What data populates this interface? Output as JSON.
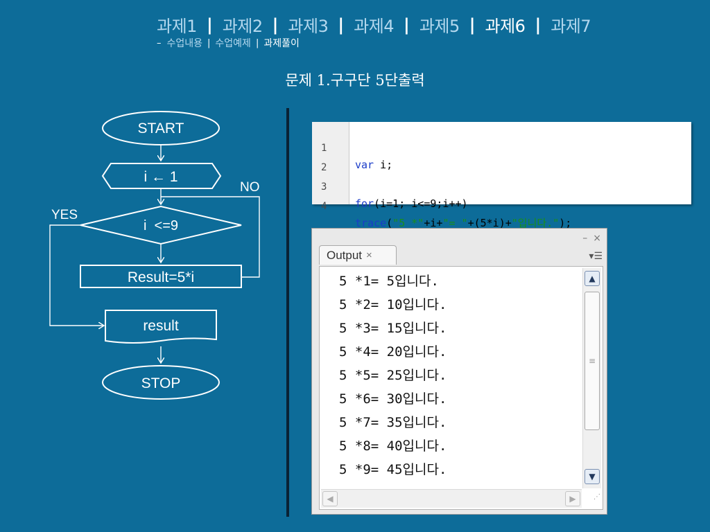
{
  "nav": {
    "tabs": [
      "과제1",
      "과제2",
      "과제3",
      "과제4",
      "과제5",
      "과제6",
      "과제7"
    ],
    "active_tab": "과제6",
    "separator": "|",
    "sub_prefix": "–",
    "sub_items": [
      "수업내용",
      "수업예제",
      "과제풀이"
    ],
    "active_sub": "과제풀이"
  },
  "page_title": "문제 1.구구단 5단출력",
  "flowchart": {
    "start": "START",
    "init": "i ← 1",
    "condition": "i  <=9",
    "process": "Result=5*i",
    "output": "result",
    "stop": "STOP",
    "yes_label": "YES",
    "no_label": "NO"
  },
  "code": {
    "lines": [
      {
        "num": "1",
        "kw": "var",
        "rest": " i;"
      },
      {
        "num": "2",
        "kw": "",
        "rest": ""
      },
      {
        "num": "3",
        "kw": "for",
        "rest": "(i=1; i<=9;i++)"
      },
      {
        "num": "4",
        "kw": "trace",
        "rest": "(\"5 *\"+i+\"= \"+(5*i)+\"입니다.\");"
      }
    ]
  },
  "output_panel": {
    "tab_label": "Output",
    "tab_close": "×",
    "minimize": "–",
    "close": "×",
    "menu_icon": "menu-icon",
    "lines": [
      "5 *1= 5입니다.",
      "5 *2= 10입니다.",
      "5 *3= 15입니다.",
      "5 *4= 20입니다.",
      "5 *5= 25입니다.",
      "5 *6= 30입니다.",
      "5 *7= 35입니다.",
      "5 *8= 40입니다.",
      "5 *9= 45입니다."
    ]
  },
  "colors": {
    "background": "#0d6c99",
    "tab_inactive": "#b4d8ee",
    "tab_active": "#ffffff",
    "keyword": "#1a3cc8",
    "string": "#1a8f1a"
  }
}
